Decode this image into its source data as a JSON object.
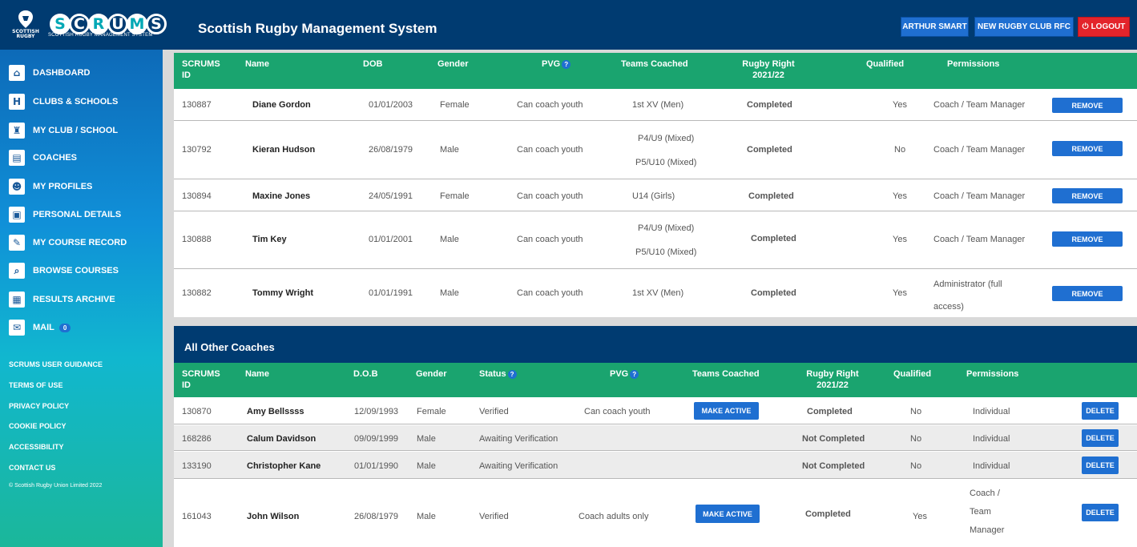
{
  "header": {
    "crest_text": "SCOTTISH RUGBY",
    "logo_letters": [
      "S",
      "C",
      "R",
      "U",
      "M",
      "S"
    ],
    "logo_sub": "SCOTTISH RUGBY MANAGEMENT SYSTEM",
    "app_title": "Scottish Rugby Management System",
    "user_button": "ARTHUR SMART",
    "club_button": "NEW RUGBY CLUB RFC",
    "logout_label": "LOGOUT",
    "logout_glyph": "⏻"
  },
  "sidebar": {
    "items": [
      {
        "label": "DASHBOARD",
        "icon": "dashboard-icon",
        "glyph": "⌂"
      },
      {
        "label": "CLUBS & SCHOOLS",
        "icon": "clubs-icon",
        "glyph": "H"
      },
      {
        "label": "MY CLUB / SCHOOL",
        "icon": "club-icon",
        "glyph": "♜"
      },
      {
        "label": "COACHES",
        "icon": "coaches-icon",
        "glyph": "▤"
      },
      {
        "label": "MY PROFILES",
        "icon": "profiles-icon",
        "glyph": "☻"
      },
      {
        "label": "PERSONAL DETAILS",
        "icon": "details-icon",
        "glyph": "▣"
      },
      {
        "label": "MY COURSE RECORD",
        "icon": "course-record-icon",
        "glyph": "✎"
      },
      {
        "label": "BROWSE COURSES",
        "icon": "browse-icon",
        "glyph": "⌕"
      },
      {
        "label": "RESULTS ARCHIVE",
        "icon": "archive-icon",
        "glyph": "▦"
      },
      {
        "label": "MAIL",
        "icon": "mail-icon",
        "glyph": "✉",
        "count": "0"
      }
    ],
    "footer_links": [
      "SCRUMS USER GUIDANCE",
      "TERMS OF USE",
      "PRIVACY POLICY",
      "COOKIE POLICY",
      "ACCESSIBILITY",
      "CONTACT US"
    ],
    "copyright": "© Scottish Rugby Union Limited 2022"
  },
  "active_table": {
    "headers": {
      "id": "SCRUMS ID",
      "name": "Name",
      "dob": "DOB",
      "gender": "Gender",
      "pvg": "PVG",
      "teams": "Teams Coached",
      "rugby_right": "Rugby Right 2021/22",
      "qualified": "Qualified",
      "permissions": "Permissions"
    },
    "help_glyph": "?",
    "rows": [
      {
        "id": "130887",
        "name": "Diane Gordon",
        "dob": "01/01/2003",
        "gender": "Female",
        "pvg": "Can coach youth",
        "teams": [
          "1st XV (Men)"
        ],
        "rugby_right": "Completed",
        "qualified": "Yes",
        "permissions": "Coach / Team Manager",
        "action": "REMOVE"
      },
      {
        "id": "130792",
        "name": "Kieran Hudson",
        "dob": "26/08/1979",
        "gender": "Male",
        "pvg": "Can coach youth",
        "teams": [
          "P4/U9 (Mixed)",
          "P5/U10 (Mixed)"
        ],
        "rugby_right": "Completed",
        "qualified": "No",
        "permissions": "Coach / Team Manager",
        "action": "REMOVE"
      },
      {
        "id": "130894",
        "name": "Maxine Jones",
        "dob": "24/05/1991",
        "gender": "Female",
        "pvg": "Can coach youth",
        "teams": [
          "U14 (Girls)"
        ],
        "rugby_right": "Completed",
        "qualified": "Yes",
        "permissions": "Coach / Team Manager",
        "action": "REMOVE"
      },
      {
        "id": "130888",
        "name": "Tim Key",
        "dob": "01/01/2001",
        "gender": "Male",
        "pvg": "Can coach youth",
        "teams": [
          "P4/U9 (Mixed)",
          "P5/U10 (Mixed)"
        ],
        "rugby_right": "Completed",
        "qualified": "Yes",
        "permissions": "Coach / Team Manager",
        "action": "REMOVE"
      },
      {
        "id": "130882",
        "name": "Tommy Wright",
        "dob": "01/01/1991",
        "gender": "Male",
        "pvg": "Can coach youth",
        "teams": [
          "1st XV (Men)"
        ],
        "rugby_right": "Completed",
        "qualified": "Yes",
        "permissions": "Administrator (full access)",
        "action": "REMOVE"
      }
    ]
  },
  "other_coaches": {
    "title": "All Other Coaches",
    "headers": {
      "id": "SCRUMS ID",
      "name": "Name",
      "dob": "D.O.B",
      "gender": "Gender",
      "status": "Status",
      "pvg": "PVG",
      "teams": "Teams Coached",
      "rugby_right": "Rugby Right 2021/22",
      "qualified": "Qualified",
      "permissions": "Permissions"
    },
    "rows": [
      {
        "id": "130870",
        "name": "Amy Bellssss",
        "dob": "12/09/1993",
        "gender": "Female",
        "status": "Verified",
        "pvg": "Can coach youth",
        "teams_button": "MAKE ACTIVE",
        "rugby_right": "Completed",
        "qualified": "No",
        "permissions": "Individual",
        "action": "DELETE"
      },
      {
        "id": "168286",
        "name": "Calum Davidson",
        "dob": "09/09/1999",
        "gender": "Male",
        "status": "Awaiting Verification",
        "pvg": "",
        "teams_button": "",
        "rugby_right": "Not Completed",
        "qualified": "No",
        "permissions": "Individual",
        "action": "DELETE"
      },
      {
        "id": "133190",
        "name": "Christopher Kane",
        "dob": "01/01/1990",
        "gender": "Male",
        "status": "Awaiting Verification",
        "pvg": "",
        "teams_button": "",
        "rugby_right": "Not Completed",
        "qualified": "No",
        "permissions": "Individual",
        "action": "DELETE"
      },
      {
        "id": "161043",
        "name": "John Wilson",
        "dob": "26/08/1979",
        "gender": "Male",
        "status": "Verified",
        "pvg": "Coach adults only",
        "teams_button": "MAKE ACTIVE",
        "rugby_right": "Completed",
        "qualified": "Yes",
        "permissions": "Coach / Team Manager",
        "action": "DELETE"
      }
    ]
  }
}
